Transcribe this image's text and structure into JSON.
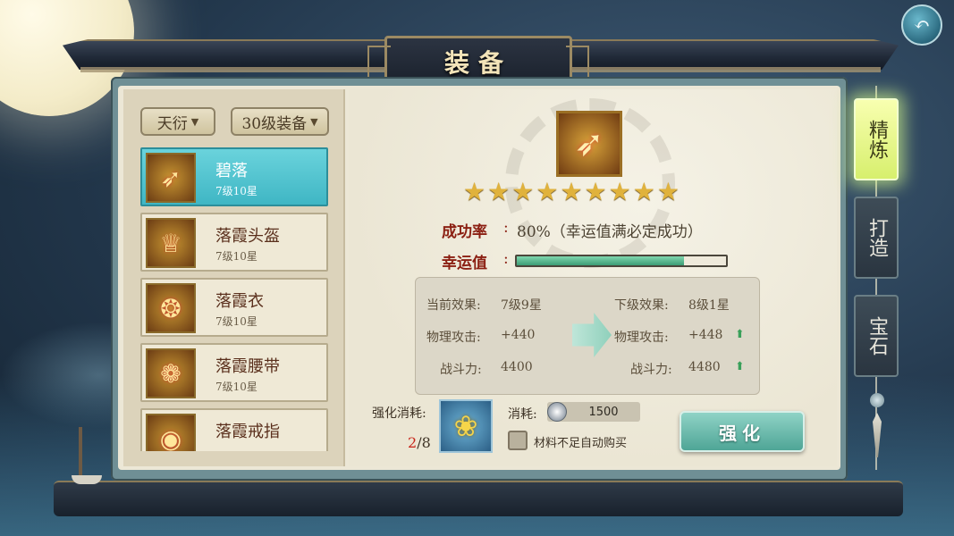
{
  "title": "装备",
  "filters": {
    "faction": "天衍",
    "level": "30级装备"
  },
  "equipment_list": [
    {
      "name": "碧落",
      "level": "7级10星",
      "selected": true,
      "icon": "bow-icon"
    },
    {
      "name": "落霞头盔",
      "level": "7级10星",
      "selected": false,
      "icon": "helmet-icon"
    },
    {
      "name": "落霞衣",
      "level": "7级10星",
      "selected": false,
      "icon": "armor-icon"
    },
    {
      "name": "落霞腰带",
      "level": "7级10星",
      "selected": false,
      "icon": "belt-icon"
    },
    {
      "name": "落霞戒指",
      "level": "",
      "selected": false,
      "icon": "ring-icon"
    }
  ],
  "detail": {
    "icon": "bow-icon",
    "stars": 9,
    "success_rate_label": "成功率",
    "success_rate_value": "80%（幸运值满必定成功）",
    "luck_label": "幸运值",
    "luck_fraction": 0.8,
    "current": {
      "effect_label": "当前效果:",
      "effect_value": "7级9星",
      "attack_label": "物理攻击:",
      "attack_value": "+440",
      "power_label": "战斗力:",
      "power_value": "4400"
    },
    "next": {
      "effect_label": "下级效果:",
      "effect_value": "8级1星",
      "attack_label": "物理攻击:",
      "attack_value": "+448",
      "power_label": "战斗力:",
      "power_value": "4480"
    }
  },
  "cost": {
    "label": "强化消耗:",
    "material_have": "2",
    "material_need": "/8",
    "material_icon": "lotus-icon",
    "spend_label": "消耗:",
    "coin_value": "1500",
    "auto_buy_label": "材料不足自动购买"
  },
  "strengthen_button": "强化",
  "side_tabs": [
    {
      "label": "精炼",
      "active": true
    },
    {
      "label": "打造",
      "active": false
    },
    {
      "label": "宝石",
      "active": false
    }
  ],
  "colors": {
    "selected_item": "#3fb6c4",
    "active_tab": "#d7ef6d",
    "highlight_red": "#8b1f12",
    "luck_fill": "#3c9c75"
  }
}
